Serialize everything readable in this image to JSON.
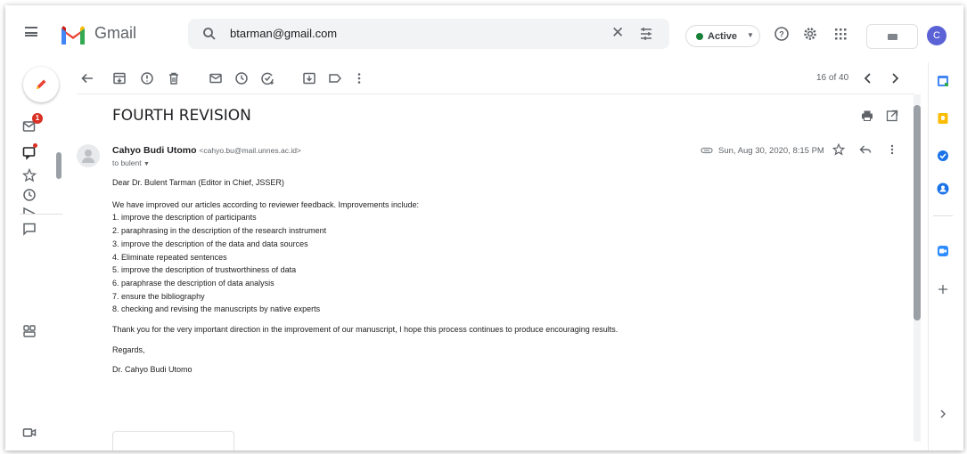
{
  "header": {
    "app_name": "Gmail",
    "search_value": "btarman@gmail.com",
    "status_label": "Active",
    "avatar_initial": "C"
  },
  "rail": {
    "inbox_badge": "1"
  },
  "toolbar": {
    "pagination": "16 of 40"
  },
  "message": {
    "subject": "FOURTH REVISION",
    "sender_name": "Cahyo Budi Utomo",
    "sender_email": "<cahyo.bu@mail.unnes.ac.id>",
    "to": "to bulent",
    "date": "Sun, Aug 30, 2020, 8:15 PM",
    "greeting": "Dear Dr. Bulent Tarman (Editor in Chief, JSSER)",
    "intro": "We have improved our articles according to reviewer feedback. Improvements include:",
    "items": [
      "1. improve the description of participants",
      "2. paraphrasing in the description of the research instrument",
      "3. improve the description of the data and data sources",
      "4. Eliminate repeated sentences",
      "5. improve the description of trustworthiness of data",
      "6. paraphrase the description of data analysis",
      "7. ensure the bibliography",
      "8. checking and revising the manuscripts by native experts"
    ],
    "thanks": "Thank you for the very important direction in the improvement of our manuscript, I hope this process continues to produce encouraging results.",
    "closing": "Regards,",
    "signature": "Dr. Cahyo Budi Utomo"
  },
  "colors": {
    "gmail_red": "#ea4335",
    "active_green": "#188038",
    "avatar_bg": "#5b62d6",
    "badge_red": "#d93025"
  }
}
